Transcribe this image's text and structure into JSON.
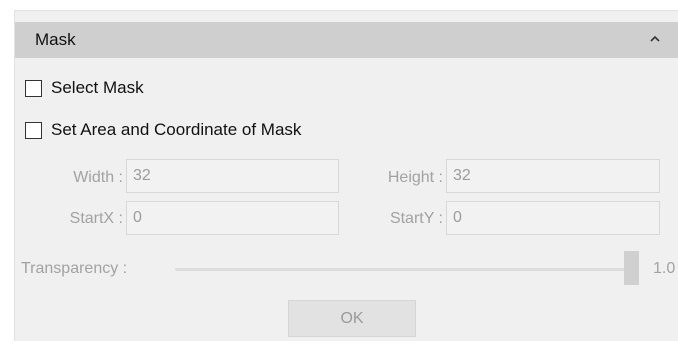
{
  "panel": {
    "title": "Mask",
    "collapse_icon": "chevron-up-icon"
  },
  "options": {
    "select_mask": {
      "label": "Select Mask",
      "checked": false
    },
    "set_area": {
      "label": "Set Area and Coordinate of Mask",
      "checked": false
    }
  },
  "fields": {
    "width": {
      "label": "Width :",
      "value": "32"
    },
    "height": {
      "label": "Height :",
      "value": "32"
    },
    "start_x": {
      "label": "StartX :",
      "value": "0"
    },
    "start_y": {
      "label": "StartY :",
      "value": "0"
    }
  },
  "transparency": {
    "label": "Transparency :",
    "value": "1.0"
  },
  "ok_button": {
    "label": "OK"
  },
  "colors": {
    "header_bg": "#cfcfcf",
    "panel_bg": "#f0f0f0",
    "disabled_text": "#a2a2a2"
  }
}
